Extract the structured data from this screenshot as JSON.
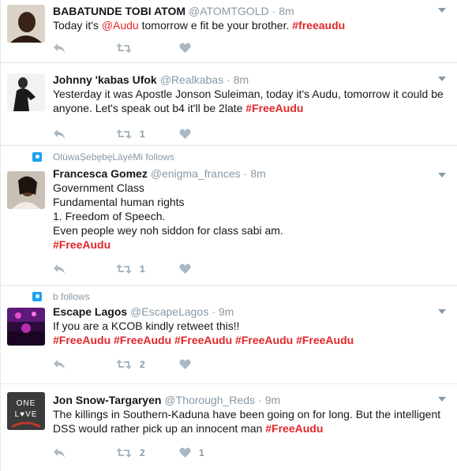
{
  "tweets": [
    {
      "name": "BABATUNDE TOBI ATOM",
      "handle": "@ATOMTGOLD",
      "sep": "·",
      "time": "8m",
      "pre": "Today it's ",
      "mention": "@Audu",
      "mid": " tomorrow e fit be your brother. ",
      "hashtag": "#freeaudu"
    },
    {
      "name": "Johnny 'kabas Ufok",
      "handle": "@Realkabas",
      "sep": "·",
      "time": "8m",
      "line1": "Yesterday it was Apostle Jonson Suleiman, today it's Audu, tomorrow it could be",
      "line2": "anyone. Let's speak out b4 it'll be 2late  ",
      "hashtag": "#FreeAudu",
      "retweets": "1"
    },
    {
      "context": "OlúwaṢebębęLáyéMi follows",
      "name": "Francesca Gomez",
      "handle": "@enigma_frances",
      "sep": "·",
      "time": "8m",
      "lines": [
        "Government Class",
        "Fundamental human rights",
        "1. Freedom of Speech.",
        "Even people wey noh siddon for class sabi am."
      ],
      "hashtag": "#FreeAudu",
      "retweets": "1"
    },
    {
      "context": "b follows",
      "name": "Escape Lagos",
      "handle": "@EscapeLagos",
      "sep": "·",
      "time": "9m",
      "line1": "If you are a KCOB kindly retweet this!!",
      "hashtags": [
        "#FreeAudu",
        "#FreeAudu",
        "#FreeAudu",
        "#FreeAudu",
        "#FreeAudu"
      ],
      "retweets": "2"
    },
    {
      "name": "Jon Snow-Targaryen",
      "handle": "@Thorough_Reds",
      "sep": "·",
      "time": "9m",
      "line1": "The killings in Southern-Kaduna have been going on for long. But the intelligent",
      "line2": "DSS would rather pick up an innocent man ",
      "hashtag": "#FreeAudu",
      "retweets": "2",
      "likes": "1",
      "avatar_text_top": "ONE",
      "avatar_text_bottom": "L♥VE"
    }
  ],
  "colors": {
    "hashtag": "#e0262a",
    "muted": "#8899a6",
    "icon": "#aab8c2",
    "divider": "#e1e8ed"
  }
}
